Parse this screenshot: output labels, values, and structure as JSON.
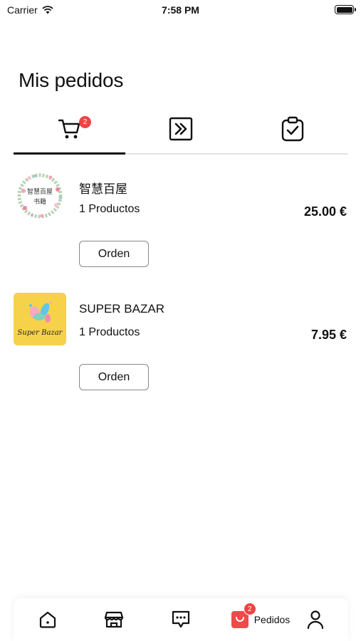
{
  "status_bar": {
    "carrier": "Carrier",
    "time": "7:58 PM",
    "wifi_icon": "wifi-icon",
    "battery_icon": "battery-icon"
  },
  "header": {
    "title": "Mis pedidos"
  },
  "tabs": [
    {
      "icon": "cart-icon",
      "badge": "2",
      "active": true
    },
    {
      "icon": "forward-icon",
      "active": false
    },
    {
      "icon": "clipboard-check-icon",
      "active": false
    }
  ],
  "orders": [
    {
      "store_name": "智慧百屋",
      "logo_text_line1": "智慧百屋",
      "logo_text_line2": "书籍",
      "product_count": "1 Productos",
      "price": "25.00 €",
      "button_label": "Orden"
    },
    {
      "store_name": "SUPER BAZAR",
      "logo_text": "Super Bazar",
      "product_count": "1 Productos",
      "price": "7.95 €",
      "button_label": "Orden"
    }
  ],
  "bottom_nav": {
    "items": [
      {
        "icon": "home-icon"
      },
      {
        "icon": "store-icon"
      },
      {
        "icon": "chat-icon"
      },
      {
        "icon": "orders-bag-icon",
        "label": "Pedidos",
        "badge": "2",
        "active": true
      },
      {
        "icon": "profile-icon"
      }
    ]
  },
  "colors": {
    "accent": "#ef4a4a",
    "text": "#111111",
    "divider": "#e4e4e4",
    "bazar_yellow": "#f6d24a"
  }
}
